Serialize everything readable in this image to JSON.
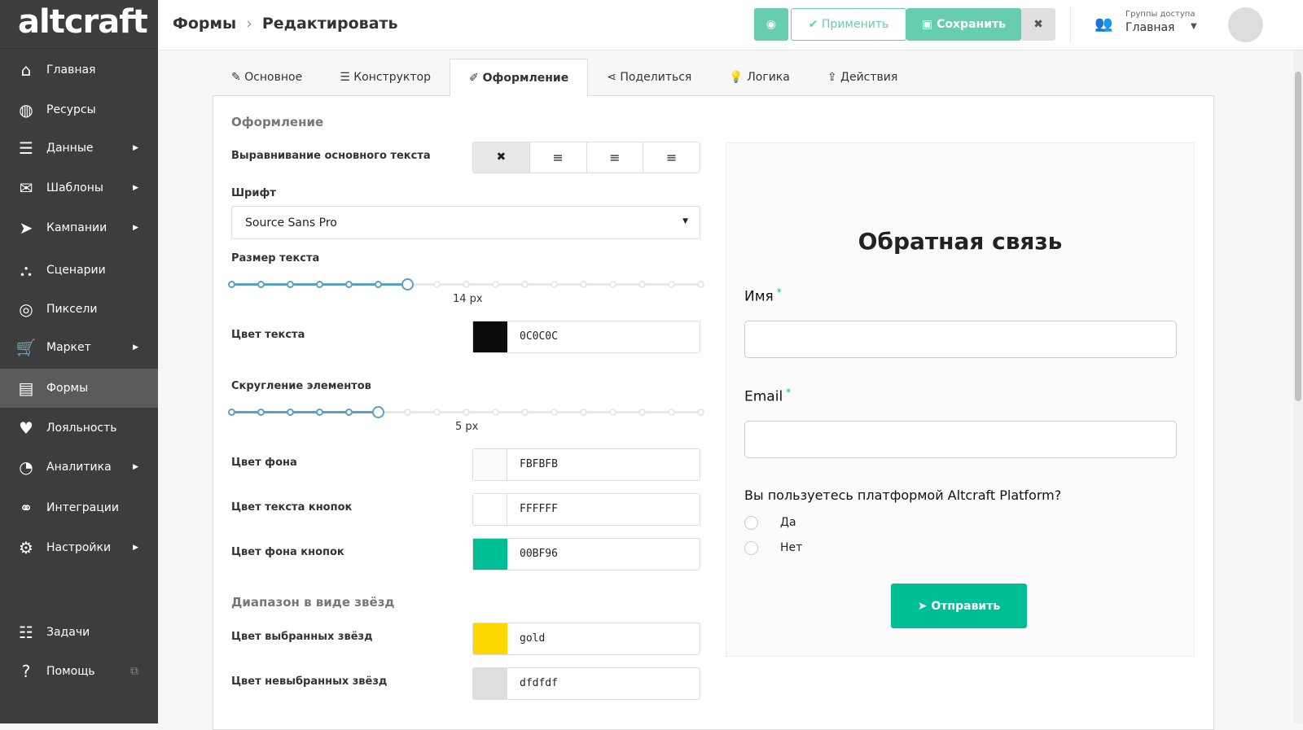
{
  "logo": "altcraft",
  "sidebar": {
    "items": [
      {
        "label": "Главная",
        "icon": "home-icon",
        "g": "⌂",
        "arrow": false
      },
      {
        "label": "Ресурсы",
        "icon": "globe-icon",
        "g": "◍",
        "arrow": false
      },
      {
        "label": "Данные",
        "icon": "database-icon",
        "g": "☰",
        "arrow": true
      },
      {
        "label": "Шаблоны",
        "icon": "envelope-icon",
        "g": "✉",
        "arrow": true
      },
      {
        "label": "Кампании",
        "icon": "paper-plane-icon",
        "g": "➤",
        "arrow": true
      },
      {
        "label": "Сценарии",
        "icon": "sitemap-icon",
        "g": "⛬",
        "arrow": false
      },
      {
        "label": "Пиксели",
        "icon": "target-icon",
        "g": "◎",
        "arrow": false
      },
      {
        "label": "Маркет",
        "icon": "cart-icon",
        "g": "🛒",
        "arrow": true
      },
      {
        "label": "Формы",
        "icon": "clipboard-icon",
        "g": "▤",
        "arrow": false,
        "active": true
      },
      {
        "label": "Лояльность",
        "icon": "heart-icon",
        "g": "♥",
        "arrow": false
      },
      {
        "label": "Аналитика",
        "icon": "pie-chart-icon",
        "g": "◔",
        "arrow": true
      },
      {
        "label": "Интеграции",
        "icon": "link-icon",
        "g": "⚭",
        "arrow": false
      },
      {
        "label": "Настройки",
        "icon": "gear-icon",
        "g": "⚙",
        "arrow": true
      },
      {
        "label": "Задачи",
        "icon": "tasks-icon",
        "g": "☷",
        "arrow": false
      },
      {
        "label": "Помощь",
        "icon": "help-icon",
        "g": "?",
        "arrow": false
      }
    ]
  },
  "header": {
    "breadcrumb": [
      "Формы",
      "Редактировать"
    ],
    "apply": "Применить",
    "save": "Сохранить",
    "access_label": "Группы доступа",
    "access_value": "Главная"
  },
  "tabs": [
    "Основное",
    "Конструктор",
    "Оформление",
    "Поделиться",
    "Логика",
    "Действия"
  ],
  "form": {
    "section": "Оформление",
    "align_label": "Выравнивание основного текста",
    "font_label": "Шрифт",
    "font_value": "Source Sans Pro",
    "size_label": "Размер текста",
    "size_value": "14 px",
    "size_index": 6,
    "size_steps": 17,
    "text_color_label": "Цвет текста",
    "text_color": "0C0C0C",
    "radius_label": "Скругление элементов",
    "radius_value": "5 px",
    "radius_index": 5,
    "radius_steps": 17,
    "bg_label": "Цвет фона",
    "bg": "FBFBFB",
    "btn_text_label": "Цвет текста кнопок",
    "btn_text": "FFFFFF",
    "btn_bg_label": "Цвет фона кнопок",
    "btn_bg": "00BF96",
    "stars_section": "Диапазон в виде звёзд",
    "star_sel_label": "Цвет выбранных звёзд",
    "star_sel": "gold",
    "star_unsel_label": "Цвет невыбранных звёзд",
    "star_unsel": "dfdfdf"
  },
  "swatches": {
    "text": "#0C0C0C",
    "bg": "#FBFBFB",
    "btn_text": "#FFFFFF",
    "btn_bg": "#00BF96",
    "star_sel": "#FFD700",
    "star_unsel": "#DFDFDF"
  },
  "preview": {
    "title": "Обратная связь",
    "name_label": "Имя",
    "email_label": "Email",
    "required": "*",
    "question": "Вы пользуетесь платформой Altcraft Platform?",
    "options": [
      "Да",
      "Нет"
    ],
    "submit": "Отправить"
  }
}
